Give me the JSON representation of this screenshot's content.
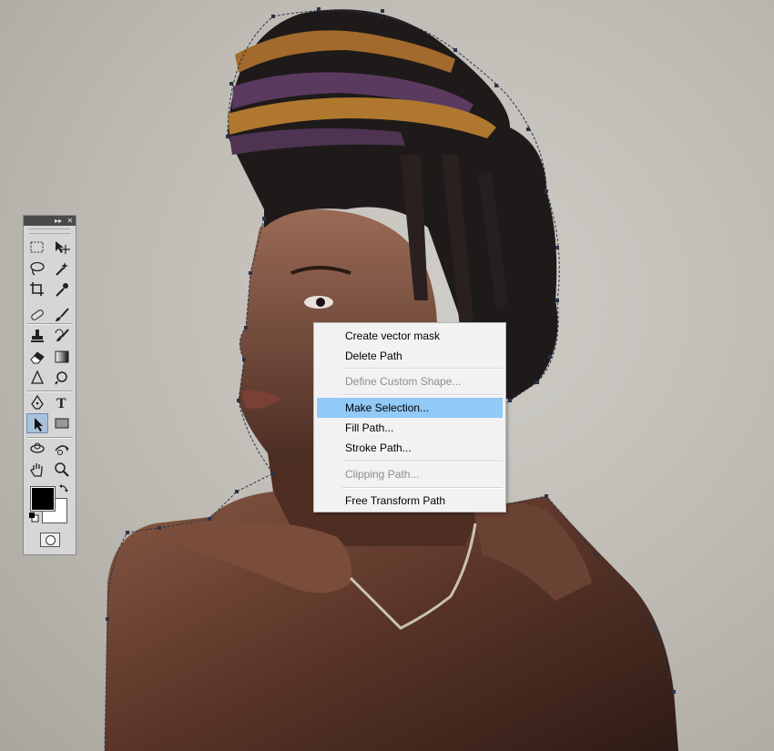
{
  "toolbox": {
    "titlebar": {
      "collapse_glyph": "▸▸",
      "close_glyph": "✕"
    },
    "tools": [
      [
        "rectangular-marquee-icon",
        "move-icon"
      ],
      [
        "lasso-icon",
        "magic-wand-icon"
      ],
      [
        "crop-icon",
        "eyedropper-icon"
      ],
      [
        "spot-healing-icon",
        "brush-icon"
      ],
      [
        "clone-stamp-icon",
        "history-brush-icon"
      ],
      [
        "eraser-icon",
        "gradient-icon"
      ],
      [
        "blur-icon",
        "dodge-icon"
      ],
      [
        "pen-icon",
        "type-icon"
      ],
      [
        "path-selection-icon",
        "rectangle-shape-icon"
      ],
      [
        "3d-rotate-icon",
        "3d-orbit-icon"
      ],
      [
        "hand-icon",
        "zoom-icon"
      ]
    ],
    "type_tool_glyph": "T",
    "active_tool": "path-selection-icon",
    "foreground_color": "#000000",
    "background_color": "#ffffff"
  },
  "context_menu": {
    "items": [
      {
        "label": "Create vector mask",
        "enabled": true,
        "highlighted": false
      },
      {
        "label": "Delete Path",
        "enabled": true,
        "highlighted": false
      },
      {
        "label": "Define Custom Shape...",
        "enabled": false,
        "highlighted": false
      },
      {
        "label": "Make Selection...",
        "enabled": true,
        "highlighted": true
      },
      {
        "label": "Fill Path...",
        "enabled": true,
        "highlighted": false
      },
      {
        "label": "Stroke Path...",
        "enabled": true,
        "highlighted": false
      },
      {
        "label": "Clipping Path...",
        "enabled": false,
        "highlighted": false
      },
      {
        "label": "Free Transform Path",
        "enabled": true,
        "highlighted": false
      }
    ],
    "highlight_color": "#91c9f7",
    "disabled_color": "#8e8e8e"
  }
}
